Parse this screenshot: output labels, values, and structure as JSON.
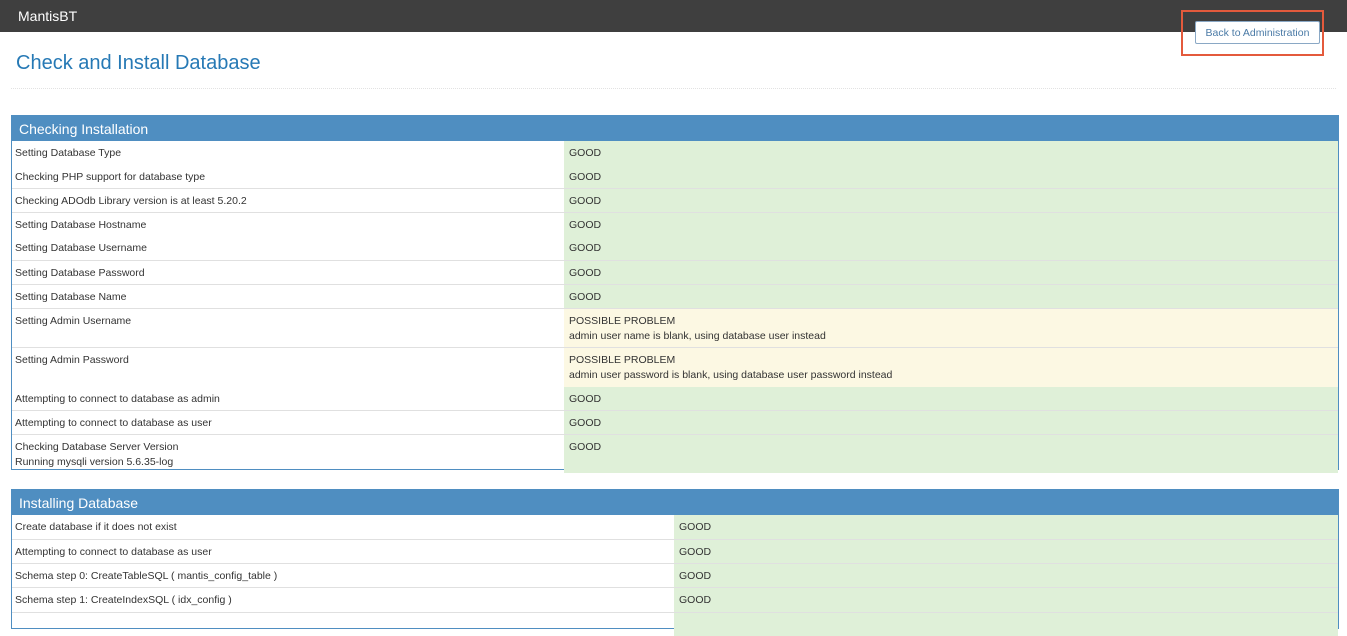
{
  "app": {
    "brand": "MantisBT"
  },
  "header": {
    "title": "Check and Install Database",
    "back_label": "Back to Administration"
  },
  "checking": {
    "title": "Checking Installation",
    "rows": [
      {
        "label": "Setting Database Type",
        "status": "GOOD"
      },
      {
        "label": "Checking PHP support for database type",
        "status": "GOOD"
      },
      {
        "label": "Checking ADOdb Library version is at least 5.20.2",
        "status": "GOOD"
      },
      {
        "label": "Setting Database Hostname",
        "status": "GOOD"
      },
      {
        "label": "Setting Database Username",
        "status": "GOOD"
      },
      {
        "label": "Setting Database Password",
        "status": "GOOD"
      },
      {
        "label": "Setting Database Name",
        "status": "GOOD"
      },
      {
        "label": "Setting Admin Username",
        "status": "POSSIBLE PROBLEM",
        "detail": "admin user name is blank, using database user instead"
      },
      {
        "label": "Setting Admin Password",
        "status": "POSSIBLE PROBLEM",
        "detail": "admin user password is blank, using database user password instead"
      },
      {
        "label": "Attempting to connect to database as admin",
        "status": "GOOD"
      },
      {
        "label": "Attempting to connect to database as user",
        "status": "GOOD"
      },
      {
        "label": "Checking Database Server Version",
        "label_detail": "Running mysqli version 5.6.35-log",
        "status": "GOOD"
      }
    ]
  },
  "installing": {
    "title": "Installing Database",
    "rows": [
      {
        "label": "Create database if it does not exist",
        "status": "GOOD"
      },
      {
        "label": "Attempting to connect to database as user",
        "status": "GOOD"
      },
      {
        "label": "Schema step 0: CreateTableSQL ( mantis_config_table )",
        "status": "GOOD"
      },
      {
        "label": "Schema step 1: CreateIndexSQL ( idx_config )",
        "status": "GOOD"
      }
    ]
  },
  "colors": {
    "navbar": "#3f3f3f",
    "accent": "#4f8ec1",
    "good": "#dff0d8",
    "warn": "#fcf8e3",
    "title": "#2679b5",
    "highlight": "#e45a3c"
  }
}
